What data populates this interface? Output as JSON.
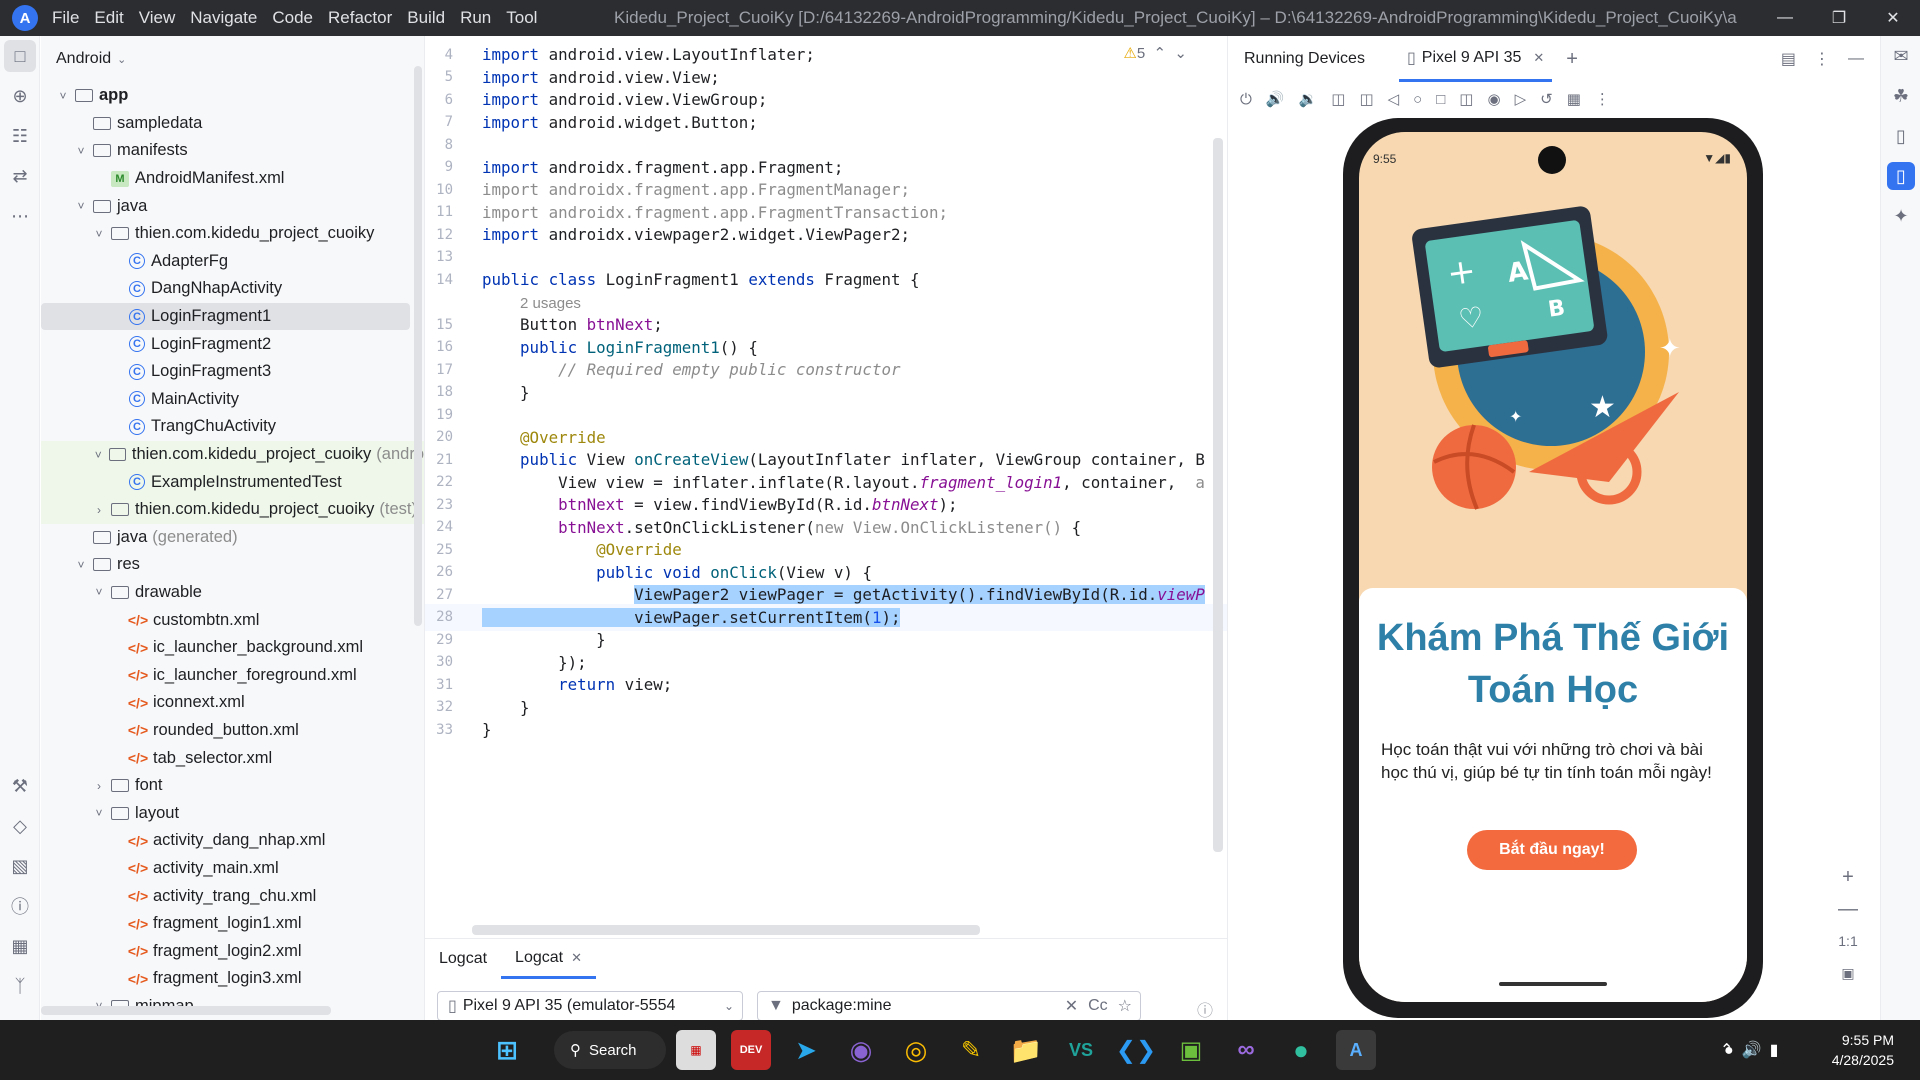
{
  "title_bar": {
    "menus": [
      "File",
      "Edit",
      "View",
      "Navigate",
      "Code",
      "Refactor",
      "Build",
      "Run",
      "Tool"
    ],
    "window_title": "Kidedu_Project_CuoiKy [D:/64132269-AndroidProgramming/Kidedu_Project_CuoiKy] – D:\\64132269-AndroidProgramming\\Kidedu_Project_CuoiKy\\a"
  },
  "project": {
    "header": "Android",
    "tree": [
      {
        "t": "app",
        "d": 0,
        "a": "v",
        "i": "folder",
        "b": true
      },
      {
        "t": "sampledata",
        "d": 1,
        "a": "",
        "i": "folder"
      },
      {
        "t": "manifests",
        "d": 1,
        "a": "v",
        "i": "folder"
      },
      {
        "t": "AndroidManifest.xml",
        "d": 2,
        "a": "",
        "i": "man"
      },
      {
        "t": "java",
        "d": 1,
        "a": "v",
        "i": "folder"
      },
      {
        "t": "thien.com.kidedu_project_cuoiky",
        "d": 2,
        "a": "v",
        "i": "folder"
      },
      {
        "t": "AdapterFg",
        "d": 3,
        "a": "",
        "i": "cls"
      },
      {
        "t": "DangNhapActivity",
        "d": 3,
        "a": "",
        "i": "cls"
      },
      {
        "t": "LoginFragment1",
        "d": 3,
        "a": "",
        "i": "cls",
        "sel": true
      },
      {
        "t": "LoginFragment2",
        "d": 3,
        "a": "",
        "i": "cls"
      },
      {
        "t": "LoginFragment3",
        "d": 3,
        "a": "",
        "i": "cls"
      },
      {
        "t": "MainActivity",
        "d": 3,
        "a": "",
        "i": "cls"
      },
      {
        "t": "TrangChuActivity",
        "d": 3,
        "a": "",
        "i": "cls"
      },
      {
        "t": "thien.com.kidedu_project_cuoiky",
        "s": "(andro",
        "d": 2,
        "a": "v",
        "i": "folder",
        "g": true
      },
      {
        "t": "ExampleInstrumentedTest",
        "d": 3,
        "a": "",
        "i": "cls",
        "g": true
      },
      {
        "t": "thien.com.kidedu_project_cuoiky",
        "s": "(test)",
        "d": 2,
        "a": ">",
        "i": "folder",
        "g": true
      },
      {
        "t": "java",
        "s": "(generated)",
        "d": 1,
        "a": "",
        "i": "folder"
      },
      {
        "t": "res",
        "d": 1,
        "a": "v",
        "i": "folder"
      },
      {
        "t": "drawable",
        "d": 2,
        "a": "v",
        "i": "folder"
      },
      {
        "t": "custombtn.xml",
        "d": 3,
        "a": "",
        "i": "xml"
      },
      {
        "t": "ic_launcher_background.xml",
        "d": 3,
        "a": "",
        "i": "xml"
      },
      {
        "t": "ic_launcher_foreground.xml",
        "d": 3,
        "a": "",
        "i": "xml"
      },
      {
        "t": "iconnext.xml",
        "d": 3,
        "a": "",
        "i": "xml"
      },
      {
        "t": "rounded_button.xml",
        "d": 3,
        "a": "",
        "i": "xml"
      },
      {
        "t": "tab_selector.xml",
        "d": 3,
        "a": "",
        "i": "xml"
      },
      {
        "t": "font",
        "d": 2,
        "a": ">",
        "i": "folder"
      },
      {
        "t": "layout",
        "d": 2,
        "a": "v",
        "i": "folder"
      },
      {
        "t": "activity_dang_nhap.xml",
        "d": 3,
        "a": "",
        "i": "xml"
      },
      {
        "t": "activity_main.xml",
        "d": 3,
        "a": "",
        "i": "xml"
      },
      {
        "t": "activity_trang_chu.xml",
        "d": 3,
        "a": "",
        "i": "xml"
      },
      {
        "t": "fragment_login1.xml",
        "d": 3,
        "a": "",
        "i": "xml"
      },
      {
        "t": "fragment_login2.xml",
        "d": 3,
        "a": "",
        "i": "xml"
      },
      {
        "t": "fragment_login3.xml",
        "d": 3,
        "a": "",
        "i": "xml"
      },
      {
        "t": "mipmap",
        "d": 2,
        "a": "v",
        "i": "folder"
      }
    ]
  },
  "editor": {
    "warnings": "5",
    "lines": [
      {
        "n": "4",
        "h": "<span class='kw'>import</span> android.view.LayoutInflater;"
      },
      {
        "n": "5",
        "h": "<span class='kw'>import</span> android.view.View;"
      },
      {
        "n": "6",
        "h": "<span class='kw'>import</span> android.view.ViewGroup;"
      },
      {
        "n": "7",
        "h": "<span class='kw'>import</span> android.widget.Button;"
      },
      {
        "n": "8",
        "h": ""
      },
      {
        "n": "9",
        "h": "<span class='kw'>import</span> androidx.fragment.app.Fragment;"
      },
      {
        "n": "10",
        "h": "<span class='st'>import androidx.fragment.app.FragmentManager;</span>"
      },
      {
        "n": "11",
        "h": "<span class='st'>import androidx.fragment.app.FragmentTransaction;</span>"
      },
      {
        "n": "12",
        "h": "<span class='kw'>import</span> androidx.viewpager2.widget.ViewPager2;"
      },
      {
        "n": "13",
        "h": ""
      },
      {
        "n": "14",
        "h": "<span class='kw'>public class</span> LoginFragment1 <span class='kw'>extends</span> Fragment {"
      },
      {
        "n": "",
        "h": "    <span class='hint'>2 usages</span>"
      },
      {
        "n": "15",
        "h": "    Button <span class='fd'>btnNext</span>;"
      },
      {
        "n": "16",
        "h": "    <span class='kw'>public</span> <span class='fn'>LoginFragment1</span>() {"
      },
      {
        "n": "17",
        "h": "        <span class='cm'>// Required empty public constructor</span>"
      },
      {
        "n": "18",
        "h": "    }"
      },
      {
        "n": "19",
        "h": ""
      },
      {
        "n": "20",
        "h": "    <span class='an'>@Override</span>"
      },
      {
        "n": "21",
        "h": "    <span class='kw'>public</span> View <span class='fn'>onCreateView</span>(LayoutInflater inflater, ViewGroup container, B"
      },
      {
        "n": "22",
        "h": "        View view = inflater.inflate(R.layout.<span class='it'>fragment_login1</span>, container,  <span class='st'>a</span>"
      },
      {
        "n": "23",
        "h": "        <span class='fd'>btnNext</span> = view.findViewById(R.id.<span class='it'>btnNext</span>);"
      },
      {
        "n": "24",
        "h": "        <span class='fd'>btnNext</span>.setOnClickListener(<span class='st'>new View.OnClickListener()</span> {"
      },
      {
        "n": "25",
        "h": "            <span class='an'>@Override</span>"
      },
      {
        "n": "26",
        "h": "            <span class='kw'>public void</span> <span class='fn'>onClick</span>(View v) {"
      },
      {
        "n": "27",
        "h": "                <span class='sel'>ViewPager2 viewPager = getActivity().findViewById(R.id.<span class='it'>viewP</span></span>"
      },
      {
        "n": "28",
        "h": "<span class='sel'>                viewPager.setCurrentItem(<span class='nm'>1</span>);</span>"
      },
      {
        "n": "29",
        "h": "            }"
      },
      {
        "n": "30",
        "h": "        });"
      },
      {
        "n": "31",
        "h": "        <span class='kw'>return</span> view;"
      },
      {
        "n": "32",
        "h": "    }"
      },
      {
        "n": "33",
        "h": "}"
      }
    ]
  },
  "logcat": {
    "tab1": "Logcat",
    "tab2": "Logcat",
    "device": "Pixel 9 API 35 (emulator-5554",
    "filter": "package:mine",
    "case": "Cc"
  },
  "running": {
    "title": "Running Devices",
    "tab": "Pixel 9 API 35",
    "zoom": "1:1"
  },
  "phone": {
    "time": "9:55",
    "title": "Khám Phá Thế Giới Toán Học",
    "body": "Học toán thật vui với những trò chơi và bài học thú vị, giúp bé tự tin tính toán mỗi ngày!",
    "cta": "Bắt đầu ngay!",
    "colors": {
      "bg": "#f7d8b0",
      "title": "#2e80a8",
      "cta": "#f26a3e"
    }
  },
  "taskbar": {
    "search": "Search",
    "time": "9:55 PM",
    "date": "4/28/2025"
  }
}
